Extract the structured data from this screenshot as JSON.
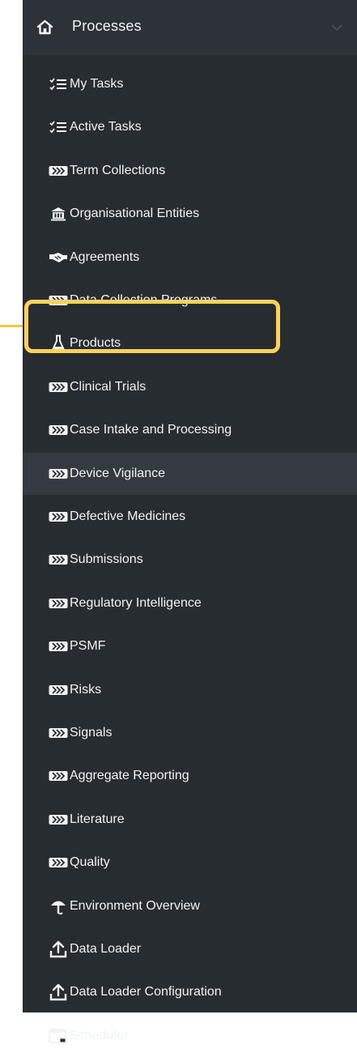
{
  "header": {
    "title": "Processes",
    "home_icon": "home-icon",
    "chevron_icon": "chevron-down-icon"
  },
  "colors": {
    "sidebar_bg": "#272c31",
    "header_bg": "#2c3238",
    "hover_bg": "#343a40",
    "text": "#f1f3f5",
    "highlight": "#fcd15d"
  },
  "menu": {
    "items": [
      {
        "label": "My Tasks",
        "icon": "tasks-checklist-icon"
      },
      {
        "label": "Active Tasks",
        "icon": "tasks-checklist-icon"
      },
      {
        "label": "Term Collections",
        "icon": "process-chevrons-icon"
      },
      {
        "label": "Organisational Entities",
        "icon": "institution-icon"
      },
      {
        "label": "Agreements",
        "icon": "handshake-icon"
      },
      {
        "label": "Data Collection Programs",
        "icon": "process-chevrons-icon"
      },
      {
        "label": "Products",
        "icon": "flask-icon"
      },
      {
        "label": "Clinical Trials",
        "icon": "process-chevrons-icon"
      },
      {
        "label": "Case Intake and Processing",
        "icon": "process-chevrons-icon"
      },
      {
        "label": "Device Vigilance",
        "icon": "process-chevrons-icon"
      },
      {
        "label": "Defective Medicines",
        "icon": "process-chevrons-icon"
      },
      {
        "label": "Submissions",
        "icon": "process-chevrons-icon"
      },
      {
        "label": "Regulatory Intelligence",
        "icon": "process-chevrons-icon"
      },
      {
        "label": "PSMF",
        "icon": "process-chevrons-icon"
      },
      {
        "label": "Risks",
        "icon": "process-chevrons-icon"
      },
      {
        "label": "Signals",
        "icon": "process-chevrons-icon"
      },
      {
        "label": "Aggregate Reporting",
        "icon": "process-chevrons-icon"
      },
      {
        "label": "Literature",
        "icon": "process-chevrons-icon"
      },
      {
        "label": "Quality",
        "icon": "process-chevrons-icon"
      },
      {
        "label": "Environment Overview",
        "icon": "environment-icon"
      },
      {
        "label": "Data Loader",
        "icon": "upload-icon"
      },
      {
        "label": "Data Loader Configuration",
        "icon": "upload-icon"
      },
      {
        "label": "Scheduler",
        "icon": "scheduler-icon"
      }
    ]
  }
}
